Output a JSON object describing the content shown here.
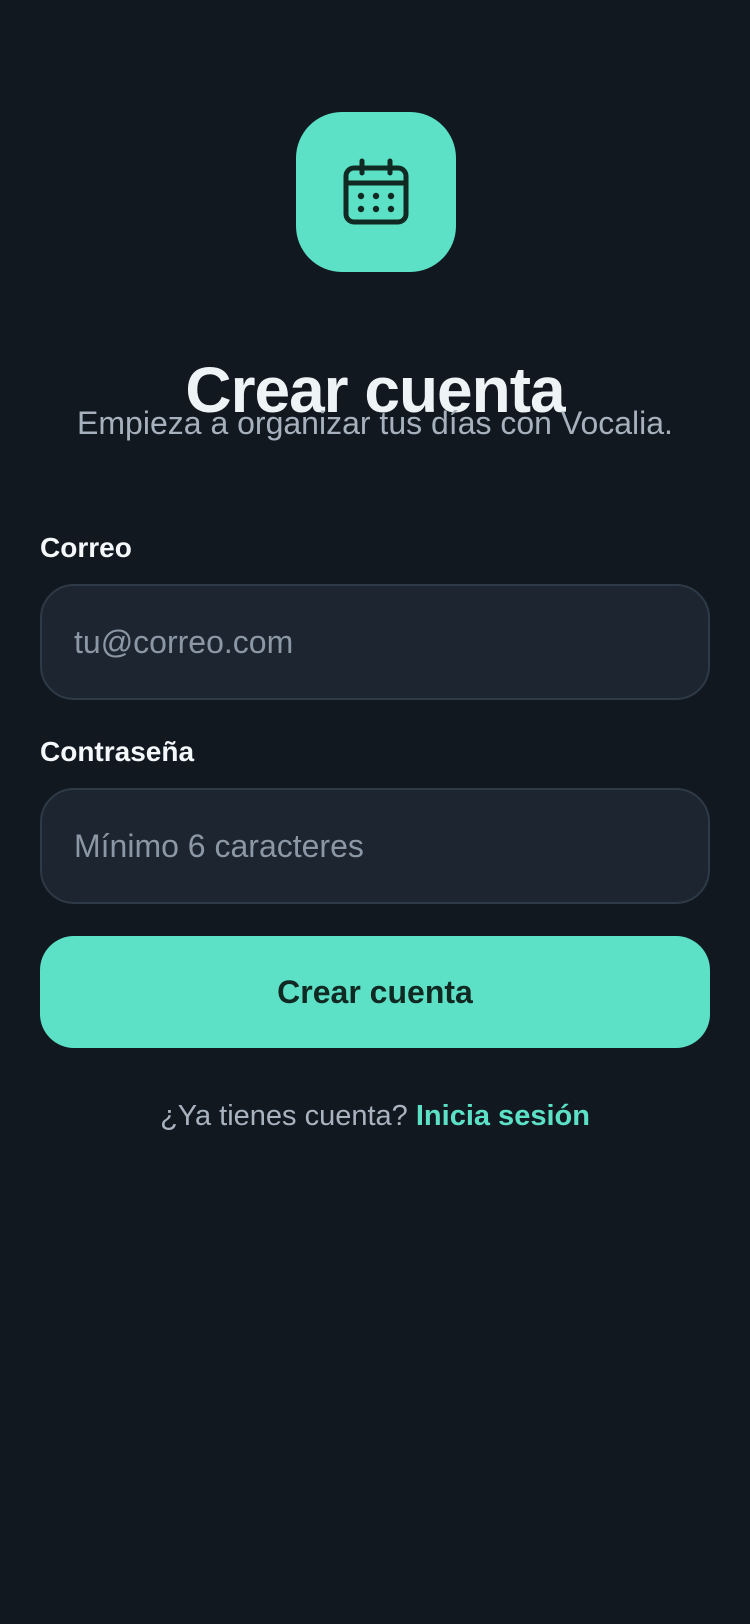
{
  "branding": {
    "icon": "calendar-icon",
    "accent_color": "#5ce0c6",
    "background_color": "#111820"
  },
  "header": {
    "title": "Crear cuenta",
    "subtitle": "Empieza a organizar tus días con Vocalia."
  },
  "form": {
    "email": {
      "label": "Correo",
      "value": "",
      "placeholder": "tu@correo.com"
    },
    "password": {
      "label": "Contraseña",
      "value": "",
      "placeholder": "Mínimo 6 caracteres"
    },
    "submit_label": "Crear cuenta"
  },
  "footer": {
    "prompt": "¿Ya tienes cuenta?",
    "link_label": "Inicia sesión"
  }
}
